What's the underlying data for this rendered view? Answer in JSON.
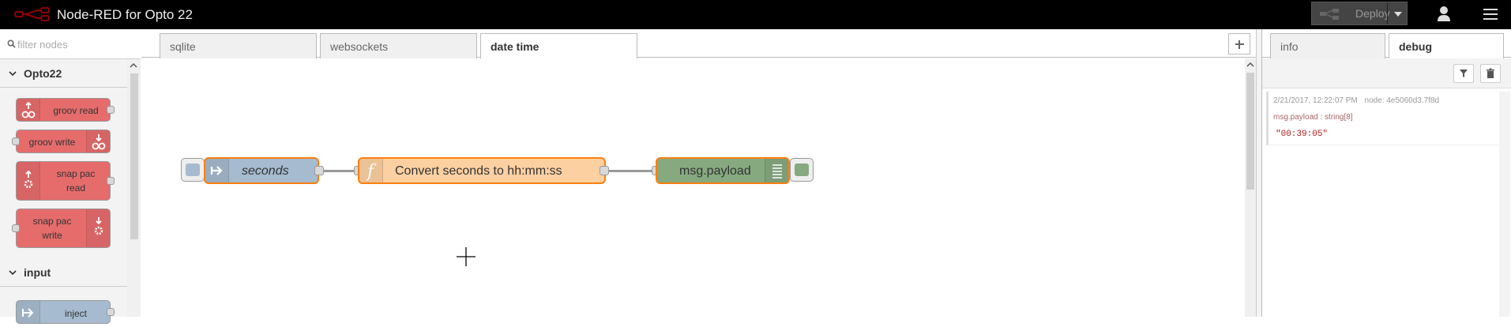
{
  "header": {
    "title": "Node-RED for Opto 22",
    "deploy_label": "Deploy"
  },
  "palette": {
    "search_placeholder": "filter nodes",
    "categories": [
      {
        "label": "Opto22",
        "nodes": [
          {
            "label": "groov read"
          },
          {
            "label": "groov write"
          },
          {
            "label_line1": "snap pac",
            "label_line2": "read"
          },
          {
            "label_line1": "snap pac",
            "label_line2": "write"
          }
        ]
      },
      {
        "label": "input",
        "nodes": [
          {
            "label": "inject"
          }
        ]
      }
    ]
  },
  "workspace": {
    "tabs": [
      {
        "label": "sqlite",
        "active": false
      },
      {
        "label": "websockets",
        "active": false
      },
      {
        "label": "date time",
        "active": true
      }
    ],
    "flow": {
      "inject_node": {
        "label": "seconds"
      },
      "function_node": {
        "label": "Convert seconds to hh:mm:ss"
      },
      "debug_node": {
        "label": "msg.payload"
      }
    }
  },
  "sidebar": {
    "tabs": [
      {
        "label": "info",
        "active": false
      },
      {
        "label": "debug",
        "active": true
      }
    ],
    "debug_messages": [
      {
        "timestamp": "2/21/2017, 12:22:07 PM",
        "node": "node: 4e5060d3.7f8d",
        "property": "msg.payload : string[8]",
        "value": "\"00:39:05\""
      }
    ]
  },
  "colors": {
    "header_bg": "#000000",
    "opto_node": "#e66c6c",
    "inject_node": "#a6bbcf",
    "function_node": "#fdd0a2",
    "debug_node": "#87a980",
    "changed_outline": "#ff7f0e"
  }
}
